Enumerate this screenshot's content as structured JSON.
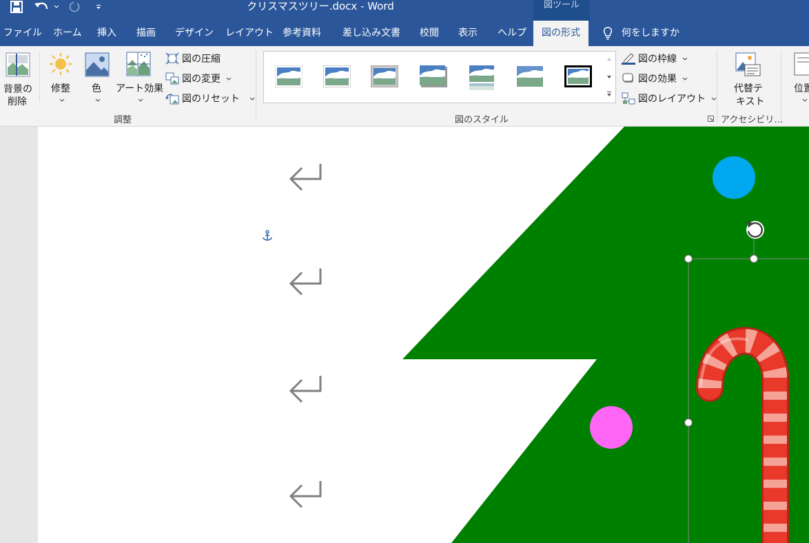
{
  "window": {
    "title": "クリスマスツリー.docx  -  Word",
    "context_tab": "図ツール"
  },
  "tabs": [
    {
      "label": "ファイル"
    },
    {
      "label": "ホーム"
    },
    {
      "label": "挿入"
    },
    {
      "label": "描画"
    },
    {
      "label": "デザイン"
    },
    {
      "label": "レイアウト"
    },
    {
      "label": "参考資料"
    },
    {
      "label": "差し込み文書"
    },
    {
      "label": "校閲"
    },
    {
      "label": "表示"
    },
    {
      "label": "ヘルプ"
    },
    {
      "label": "図の形式"
    }
  ],
  "tell_me": "何をしますか",
  "ribbon": {
    "adjust": {
      "remove_bg_line1": "背景の",
      "remove_bg_line2": "削除",
      "corrections": "修整",
      "color": "色",
      "artistic": "アート効果",
      "compress": "図の圧縮",
      "change": "図の変更",
      "reset": "図のリセット",
      "group_label": "調整"
    },
    "styles": {
      "group_label": "図のスタイル",
      "border": "図の枠線",
      "effects": "図の効果",
      "layout": "図のレイアウト"
    },
    "accessibility": {
      "alt_line1": "代替テ",
      "alt_line2": "キスト",
      "group_label": "アクセシビリ…"
    },
    "arrange": {
      "position_partial": "位置"
    }
  },
  "colors": {
    "titlebar": "#2b579a",
    "tree": "#008000",
    "ornament_blue": "#00a8f0",
    "ornament_pink": "#ff66f5",
    "candy_red": "#e8392a"
  }
}
